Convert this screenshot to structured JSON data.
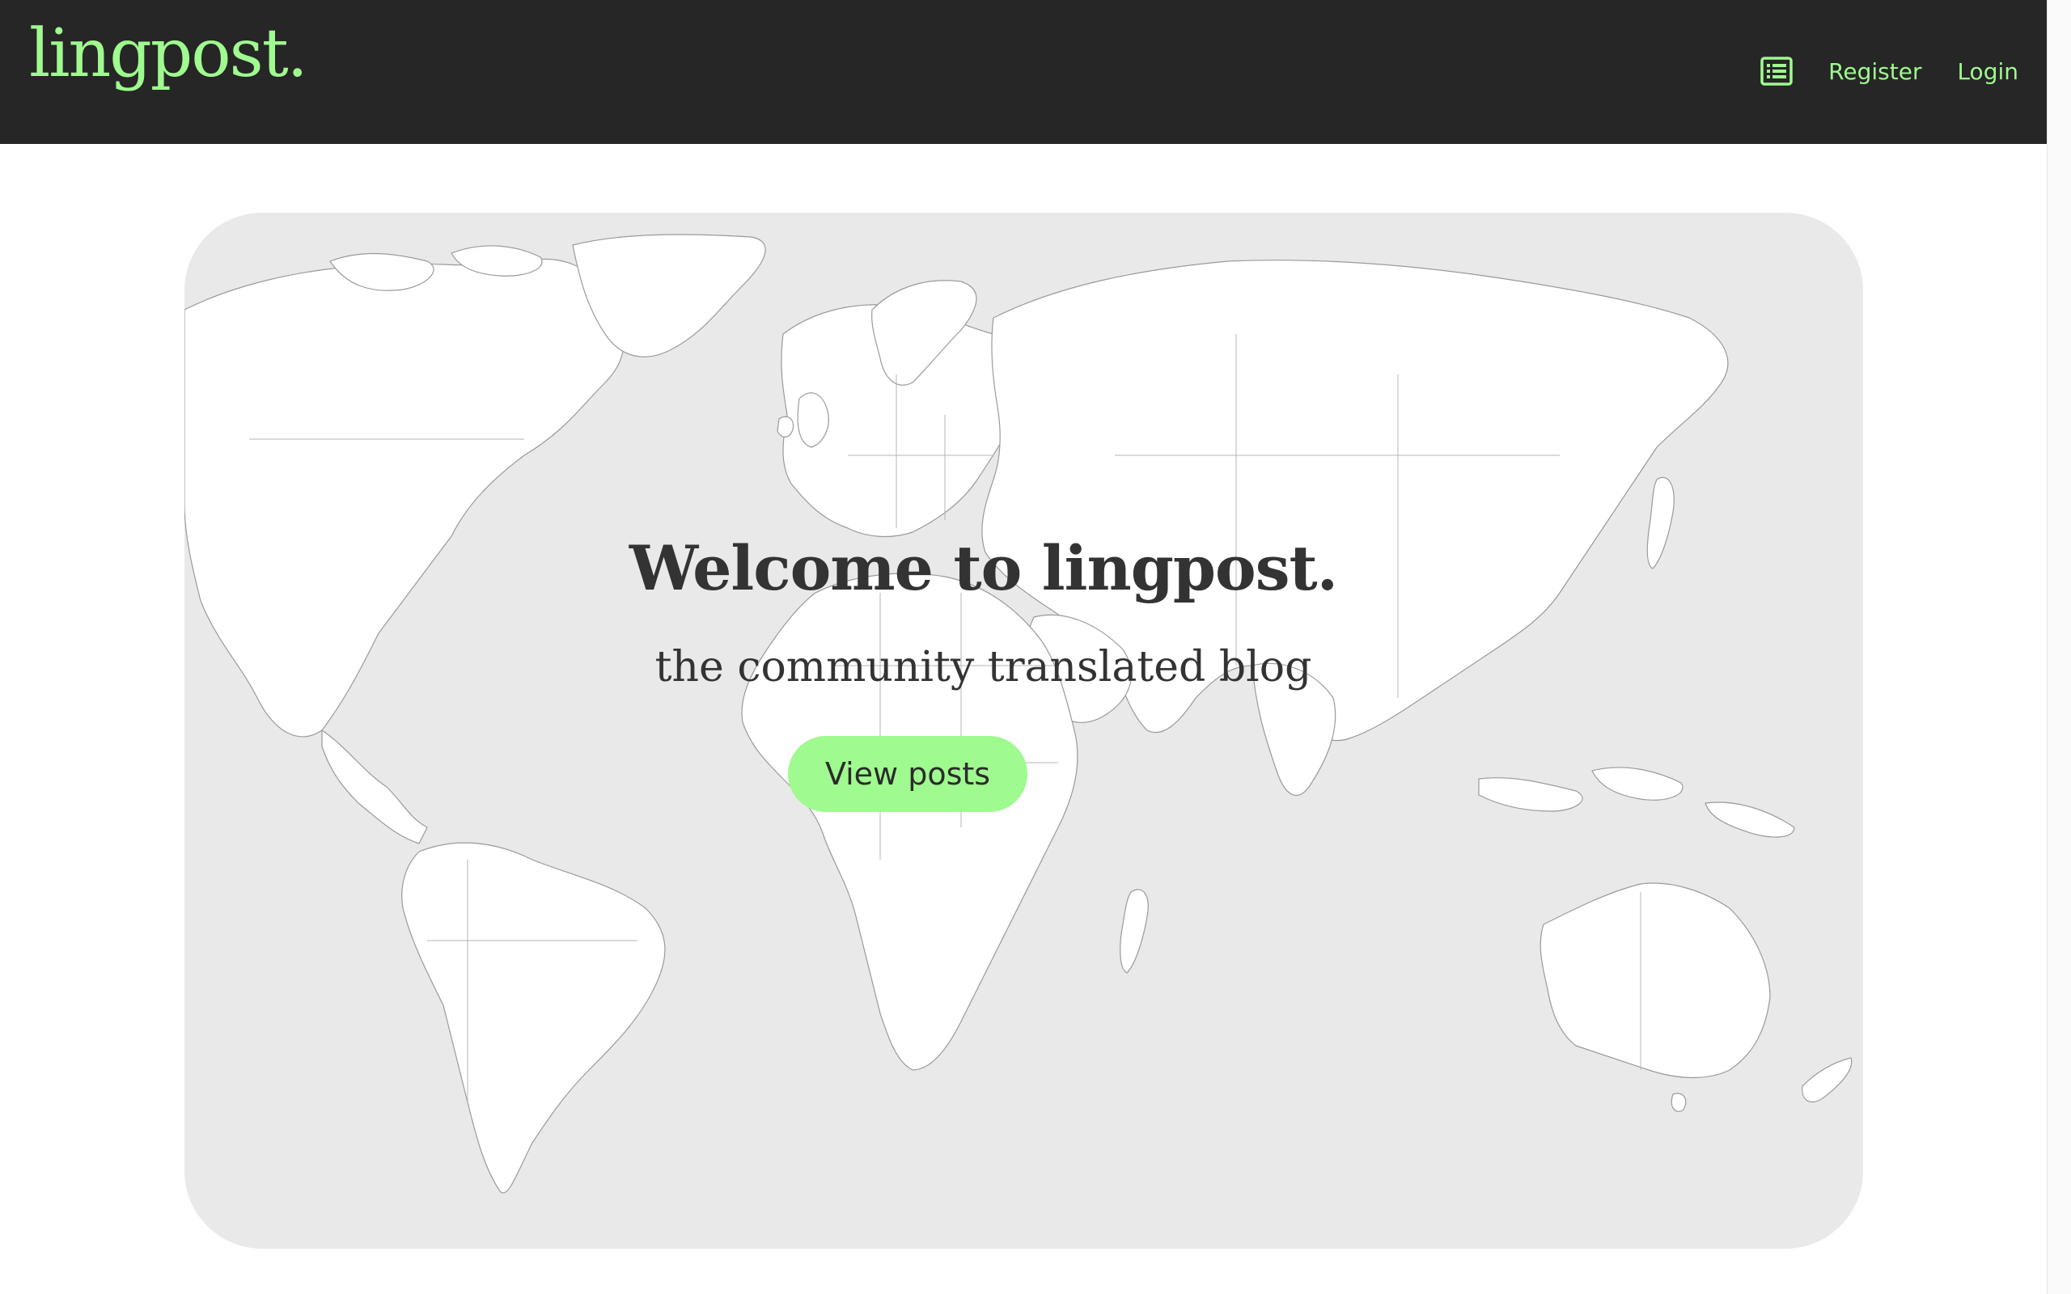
{
  "header": {
    "logo_text": "lingpost.",
    "posts_icon": "list-icon",
    "register_label": "Register",
    "login_label": "Login"
  },
  "hero": {
    "title": "Welcome to lingpost.",
    "subtitle": "the community translated blog",
    "button_label": "View posts"
  },
  "colors": {
    "navbar_bg": "#262626",
    "accent": "#9ffa8f",
    "hero_bg": "#e9e9e9",
    "text_dark": "#333333"
  }
}
